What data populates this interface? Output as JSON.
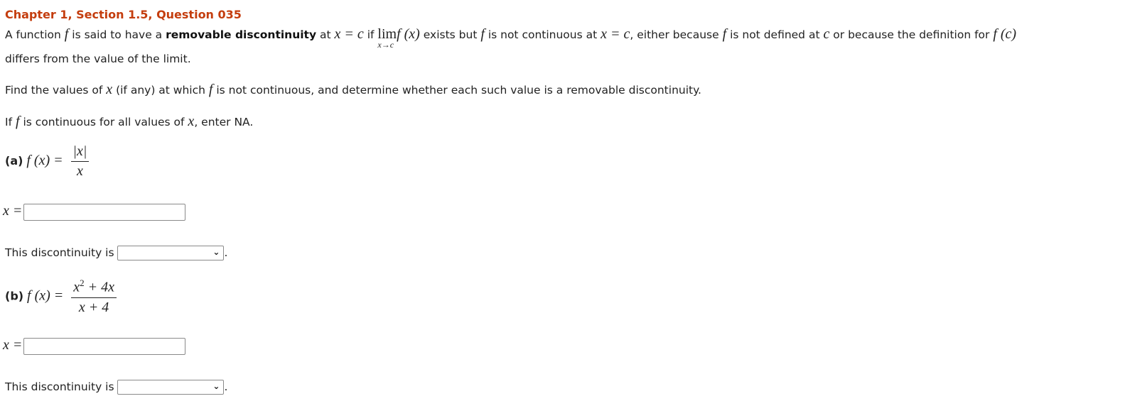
{
  "header": {
    "title": "Chapter 1, Section 1.5, Question 035"
  },
  "intro": {
    "p1_a": "A function ",
    "f": "f",
    "p1_b": " is said to have a ",
    "bold_term": "removable discontinuity",
    "p1_c": " at ",
    "x_eq_c": "x = c",
    "p1_d": " if ",
    "lim": "lim",
    "lim_sub": "x→c",
    "fx": "f (x)",
    "p1_e": " exists but ",
    "p1_f": " is not continuous at ",
    "x_eq_c2": "x = c",
    "p1_g": ", either because ",
    "p1_h": " is not defined at ",
    "c": "c",
    "p1_i": " or because the definition for ",
    "fc": "f (c)",
    "p2": "differs from the value of the limit."
  },
  "instructions": {
    "find_a": "Find the values of ",
    "x": "x",
    "find_b": " (if any) at which ",
    "f": "f",
    "find_c": " is not continuous, and determine whether each such value is a removable discontinuity.",
    "na_a": "If ",
    "na_b": " is continuous for all values of ",
    "na_c": ", enter NA."
  },
  "parts": [
    {
      "label": "(a)",
      "lhs": "f (x) =",
      "numerator": "|x|",
      "denominator": "x",
      "x_label": "x =",
      "x_value": "",
      "discontinuity_label": "This discontinuity is",
      "discontinuity_selected": "",
      "period": "."
    },
    {
      "label": "(b)",
      "lhs": "f (x) =",
      "numerator_base": "x",
      "numerator_exp": "2",
      "numerator_rest": " + 4x",
      "denominator": "x + 4",
      "x_label": "x =",
      "x_value": "",
      "discontinuity_label": "This discontinuity is",
      "discontinuity_selected": "",
      "period": "."
    }
  ],
  "icons": {
    "dropdown": "chevron-down-icon"
  },
  "colors": {
    "title": "#c43d0e",
    "text": "#222222",
    "input_border": "#8a8a8a"
  }
}
